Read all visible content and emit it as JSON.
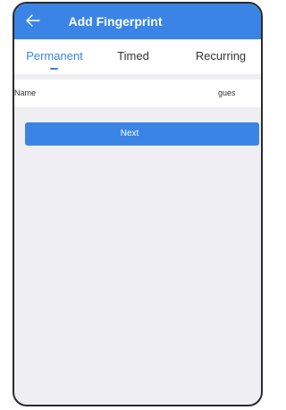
{
  "header": {
    "title": "Add Fingerprint",
    "back_icon": "arrow-left-icon"
  },
  "tabs": [
    {
      "label": "Permanent",
      "active": true
    },
    {
      "label": "Timed",
      "active": false
    },
    {
      "label": "Recurring",
      "active": false
    }
  ],
  "form": {
    "name_label": "Name",
    "name_value": "gues"
  },
  "actions": {
    "next_label": "Next"
  },
  "colors": {
    "accent": "#3a84e6",
    "background": "#efeff3",
    "text": "#333333"
  }
}
